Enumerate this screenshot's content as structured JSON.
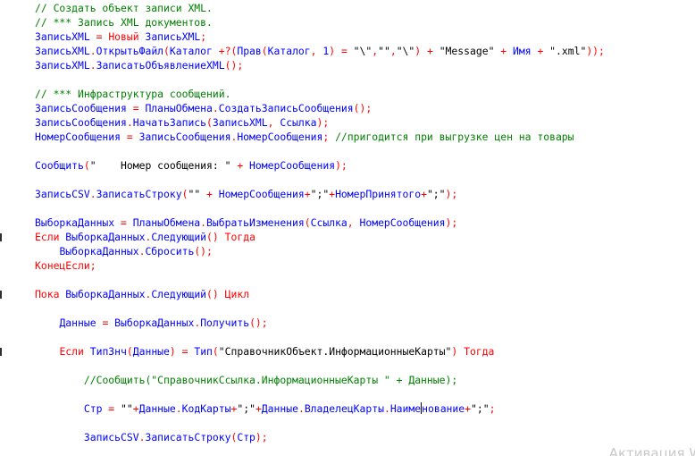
{
  "editor": {
    "lines": [
      {
        "tokens": [
          {
            "t": "// Создать объект записи XML.",
            "c": "comment"
          }
        ]
      },
      {
        "tokens": [
          {
            "t": "// *** Запись XML документов.",
            "c": "comment"
          }
        ]
      },
      {
        "tokens": [
          {
            "t": "ЗаписьXML",
            "c": "ident"
          },
          {
            "t": " = ",
            "c": "op"
          },
          {
            "t": "Новый",
            "c": "kw"
          },
          {
            "t": " ",
            "c": "op"
          },
          {
            "t": "ЗаписьXML",
            "c": "ident"
          },
          {
            "t": ";",
            "c": "punct"
          }
        ]
      },
      {
        "tokens": [
          {
            "t": "ЗаписьXML",
            "c": "ident"
          },
          {
            "t": ".",
            "c": "punct"
          },
          {
            "t": "ОткрытьФайл",
            "c": "ident"
          },
          {
            "t": "(",
            "c": "punct"
          },
          {
            "t": "Каталог",
            "c": "ident"
          },
          {
            "t": " +?(",
            "c": "op"
          },
          {
            "t": "Прав",
            "c": "ident"
          },
          {
            "t": "(",
            "c": "punct"
          },
          {
            "t": "Каталог",
            "c": "ident"
          },
          {
            "t": ", ",
            "c": "punct"
          },
          {
            "t": "1",
            "c": "ident"
          },
          {
            "t": ") = ",
            "c": "op"
          },
          {
            "t": "\"\\\"",
            "c": "string"
          },
          {
            "t": ",",
            "c": "punct"
          },
          {
            "t": "\"\"",
            "c": "string"
          },
          {
            "t": ",",
            "c": "punct"
          },
          {
            "t": "\"\\\"",
            "c": "string"
          },
          {
            "t": ") + ",
            "c": "op"
          },
          {
            "t": "\"Message\"",
            "c": "string"
          },
          {
            "t": " + ",
            "c": "op"
          },
          {
            "t": "Имя",
            "c": "ident"
          },
          {
            "t": " + ",
            "c": "op"
          },
          {
            "t": "\".xml\"",
            "c": "string"
          },
          {
            "t": "));",
            "c": "punct"
          }
        ]
      },
      {
        "tokens": [
          {
            "t": "ЗаписьXML",
            "c": "ident"
          },
          {
            "t": ".",
            "c": "punct"
          },
          {
            "t": "ЗаписатьОбъявлениеXML",
            "c": "ident"
          },
          {
            "t": "();",
            "c": "punct"
          }
        ]
      },
      {
        "tokens": []
      },
      {
        "tokens": [
          {
            "t": "// *** Инфраструктура сообщений.",
            "c": "comment"
          }
        ]
      },
      {
        "tokens": [
          {
            "t": "ЗаписьСообщения",
            "c": "ident"
          },
          {
            "t": " = ",
            "c": "op"
          },
          {
            "t": "ПланыОбмена",
            "c": "ident"
          },
          {
            "t": ".",
            "c": "punct"
          },
          {
            "t": "СоздатьЗаписьСообщения",
            "c": "ident"
          },
          {
            "t": "();",
            "c": "punct"
          }
        ]
      },
      {
        "tokens": [
          {
            "t": "ЗаписьСообщения",
            "c": "ident"
          },
          {
            "t": ".",
            "c": "punct"
          },
          {
            "t": "НачатьЗапись",
            "c": "ident"
          },
          {
            "t": "(",
            "c": "punct"
          },
          {
            "t": "ЗаписьXML",
            "c": "ident"
          },
          {
            "t": ", ",
            "c": "punct"
          },
          {
            "t": "Ссылка",
            "c": "ident"
          },
          {
            "t": ");",
            "c": "punct"
          }
        ]
      },
      {
        "tokens": [
          {
            "t": "НомерСообщения",
            "c": "ident"
          },
          {
            "t": " = ",
            "c": "op"
          },
          {
            "t": "ЗаписьСообщения",
            "c": "ident"
          },
          {
            "t": ".",
            "c": "punct"
          },
          {
            "t": "НомерСообщения",
            "c": "ident"
          },
          {
            "t": "; ",
            "c": "punct"
          },
          {
            "t": "//пригодится при выгрузке цен на товары",
            "c": "comment"
          }
        ]
      },
      {
        "tokens": []
      },
      {
        "tokens": [
          {
            "t": "Сообщить",
            "c": "ident"
          },
          {
            "t": "(",
            "c": "punct"
          },
          {
            "t": "\"    Номер сообщения: \"",
            "c": "string"
          },
          {
            "t": " + ",
            "c": "op"
          },
          {
            "t": "НомерСообщения",
            "c": "ident"
          },
          {
            "t": ");",
            "c": "punct"
          }
        ]
      },
      {
        "tokens": []
      },
      {
        "tokens": [
          {
            "t": "ЗаписьCSV",
            "c": "ident"
          },
          {
            "t": ".",
            "c": "punct"
          },
          {
            "t": "ЗаписатьСтроку",
            "c": "ident"
          },
          {
            "t": "(",
            "c": "punct"
          },
          {
            "t": "\"\"",
            "c": "string"
          },
          {
            "t": " + ",
            "c": "op"
          },
          {
            "t": "НомерСообщения",
            "c": "ident"
          },
          {
            "t": "+",
            "c": "op"
          },
          {
            "t": "\";\"",
            "c": "string"
          },
          {
            "t": "+",
            "c": "op"
          },
          {
            "t": "НомерПринятого",
            "c": "ident"
          },
          {
            "t": "+",
            "c": "op"
          },
          {
            "t": "\";\"",
            "c": "string"
          },
          {
            "t": ");",
            "c": "punct"
          }
        ]
      },
      {
        "tokens": []
      },
      {
        "tokens": [
          {
            "t": "ВыборкаДанных",
            "c": "ident"
          },
          {
            "t": " = ",
            "c": "op"
          },
          {
            "t": "ПланыОбмена",
            "c": "ident"
          },
          {
            "t": ".",
            "c": "punct"
          },
          {
            "t": "ВыбратьИзменения",
            "c": "ident"
          },
          {
            "t": "(",
            "c": "punct"
          },
          {
            "t": "Ссылка",
            "c": "ident"
          },
          {
            "t": ", ",
            "c": "punct"
          },
          {
            "t": "НомерСообщения",
            "c": "ident"
          },
          {
            "t": ");",
            "c": "punct"
          }
        ]
      },
      {
        "marker": true,
        "tokens": [
          {
            "t": "Если",
            "c": "kw"
          },
          {
            "t": " ",
            "c": "op"
          },
          {
            "t": "ВыборкаДанных",
            "c": "ident"
          },
          {
            "t": ".",
            "c": "punct"
          },
          {
            "t": "Следующий",
            "c": "ident"
          },
          {
            "t": "() ",
            "c": "punct"
          },
          {
            "t": "Тогда",
            "c": "kw"
          }
        ]
      },
      {
        "tokens": [
          {
            "t": "    ",
            "c": "op"
          },
          {
            "t": "ВыборкаДанных",
            "c": "ident"
          },
          {
            "t": ".",
            "c": "punct"
          },
          {
            "t": "Сбросить",
            "c": "ident"
          },
          {
            "t": "();",
            "c": "punct"
          }
        ]
      },
      {
        "tokens": [
          {
            "t": "КонецЕсли",
            "c": "kw"
          },
          {
            "t": ";",
            "c": "punct"
          }
        ]
      },
      {
        "tokens": []
      },
      {
        "marker": true,
        "tokens": [
          {
            "t": "Пока",
            "c": "kw"
          },
          {
            "t": " ",
            "c": "op"
          },
          {
            "t": "ВыборкаДанных",
            "c": "ident"
          },
          {
            "t": ".",
            "c": "punct"
          },
          {
            "t": "Следующий",
            "c": "ident"
          },
          {
            "t": "() ",
            "c": "punct"
          },
          {
            "t": "Цикл",
            "c": "kw"
          }
        ]
      },
      {
        "tokens": []
      },
      {
        "tokens": [
          {
            "t": "    ",
            "c": "op"
          },
          {
            "t": "Данные",
            "c": "ident"
          },
          {
            "t": " = ",
            "c": "op"
          },
          {
            "t": "ВыборкаДанных",
            "c": "ident"
          },
          {
            "t": ".",
            "c": "punct"
          },
          {
            "t": "Получить",
            "c": "ident"
          },
          {
            "t": "();",
            "c": "punct"
          }
        ]
      },
      {
        "tokens": []
      },
      {
        "marker": true,
        "tokens": [
          {
            "t": "    ",
            "c": "op"
          },
          {
            "t": "Если",
            "c": "kw"
          },
          {
            "t": " ",
            "c": "op"
          },
          {
            "t": "ТипЗнч",
            "c": "ident"
          },
          {
            "t": "(",
            "c": "punct"
          },
          {
            "t": "Данные",
            "c": "ident"
          },
          {
            "t": ") = ",
            "c": "op"
          },
          {
            "t": "Тип",
            "c": "ident"
          },
          {
            "t": "(",
            "c": "punct"
          },
          {
            "t": "\"СправочникОбъект.ИнформационныеКарты\"",
            "c": "string"
          },
          {
            "t": ") ",
            "c": "punct"
          },
          {
            "t": "Тогда",
            "c": "kw"
          }
        ]
      },
      {
        "tokens": []
      },
      {
        "tokens": [
          {
            "t": "        ",
            "c": "op"
          },
          {
            "t": "//Сообщить(\"СправочникСсылка.ИнформационныеКарты \" + Данные);",
            "c": "comment"
          }
        ]
      },
      {
        "tokens": []
      },
      {
        "tokens": [
          {
            "t": "        ",
            "c": "op"
          },
          {
            "t": "Стр",
            "c": "ident"
          },
          {
            "t": " = ",
            "c": "op"
          },
          {
            "t": "\"\"",
            "c": "string"
          },
          {
            "t": "+",
            "c": "op"
          },
          {
            "t": "Данные",
            "c": "ident"
          },
          {
            "t": ".",
            "c": "punct"
          },
          {
            "t": "КодКарты",
            "c": "ident"
          },
          {
            "t": "+",
            "c": "op"
          },
          {
            "t": "\";\"",
            "c": "string"
          },
          {
            "t": "+",
            "c": "op"
          },
          {
            "t": "Данные",
            "c": "ident"
          },
          {
            "t": ".",
            "c": "punct"
          },
          {
            "t": "ВладелецКарты",
            "c": "ident"
          },
          {
            "t": ".",
            "c": "punct"
          },
          {
            "t": "Наиме",
            "c": "ident"
          },
          {
            "t": "",
            "c": "caret"
          },
          {
            "t": "нование",
            "c": "ident"
          },
          {
            "t": "+",
            "c": "op"
          },
          {
            "t": "\";\"",
            "c": "string"
          },
          {
            "t": ";",
            "c": "punct"
          }
        ]
      },
      {
        "tokens": []
      },
      {
        "tokens": [
          {
            "t": "        ",
            "c": "op"
          },
          {
            "t": "ЗаписьCSV",
            "c": "ident"
          },
          {
            "t": ".",
            "c": "punct"
          },
          {
            "t": "ЗаписатьСтроку",
            "c": "ident"
          },
          {
            "t": "(",
            "c": "punct"
          },
          {
            "t": "Стр",
            "c": "ident"
          },
          {
            "t": ");",
            "c": "punct"
          }
        ]
      }
    ]
  },
  "watermark": "Активация Wi"
}
